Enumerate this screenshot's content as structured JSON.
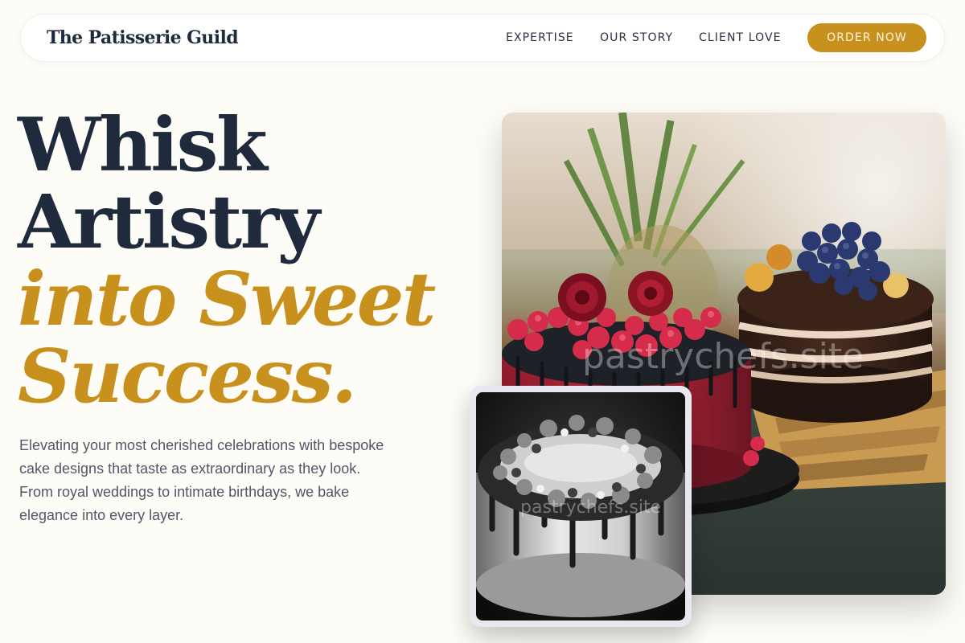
{
  "nav": {
    "brand": "The Patisserie Guild",
    "links": [
      "EXPERTISE",
      "OUR STORY",
      "CLIENT LOVE"
    ],
    "cta": "ORDER NOW"
  },
  "hero": {
    "headline_line1": "Whisk",
    "headline_line2": "Artistry",
    "headline_line3": "into Sweet",
    "headline_line4": "Success.",
    "lede": "Elevating your most cherished celebrations with bespoke cake designs that taste as extraordinary as they look. From royal weddings to intimate birthdays, we bake elegance into every layer.",
    "main_image_watermark": "pastrychefs.site",
    "small_image_watermark": "pastrychefs.site"
  },
  "colors": {
    "accent": "#c8901d",
    "navy": "#1f2a3d",
    "background": "#fdfcf7"
  }
}
